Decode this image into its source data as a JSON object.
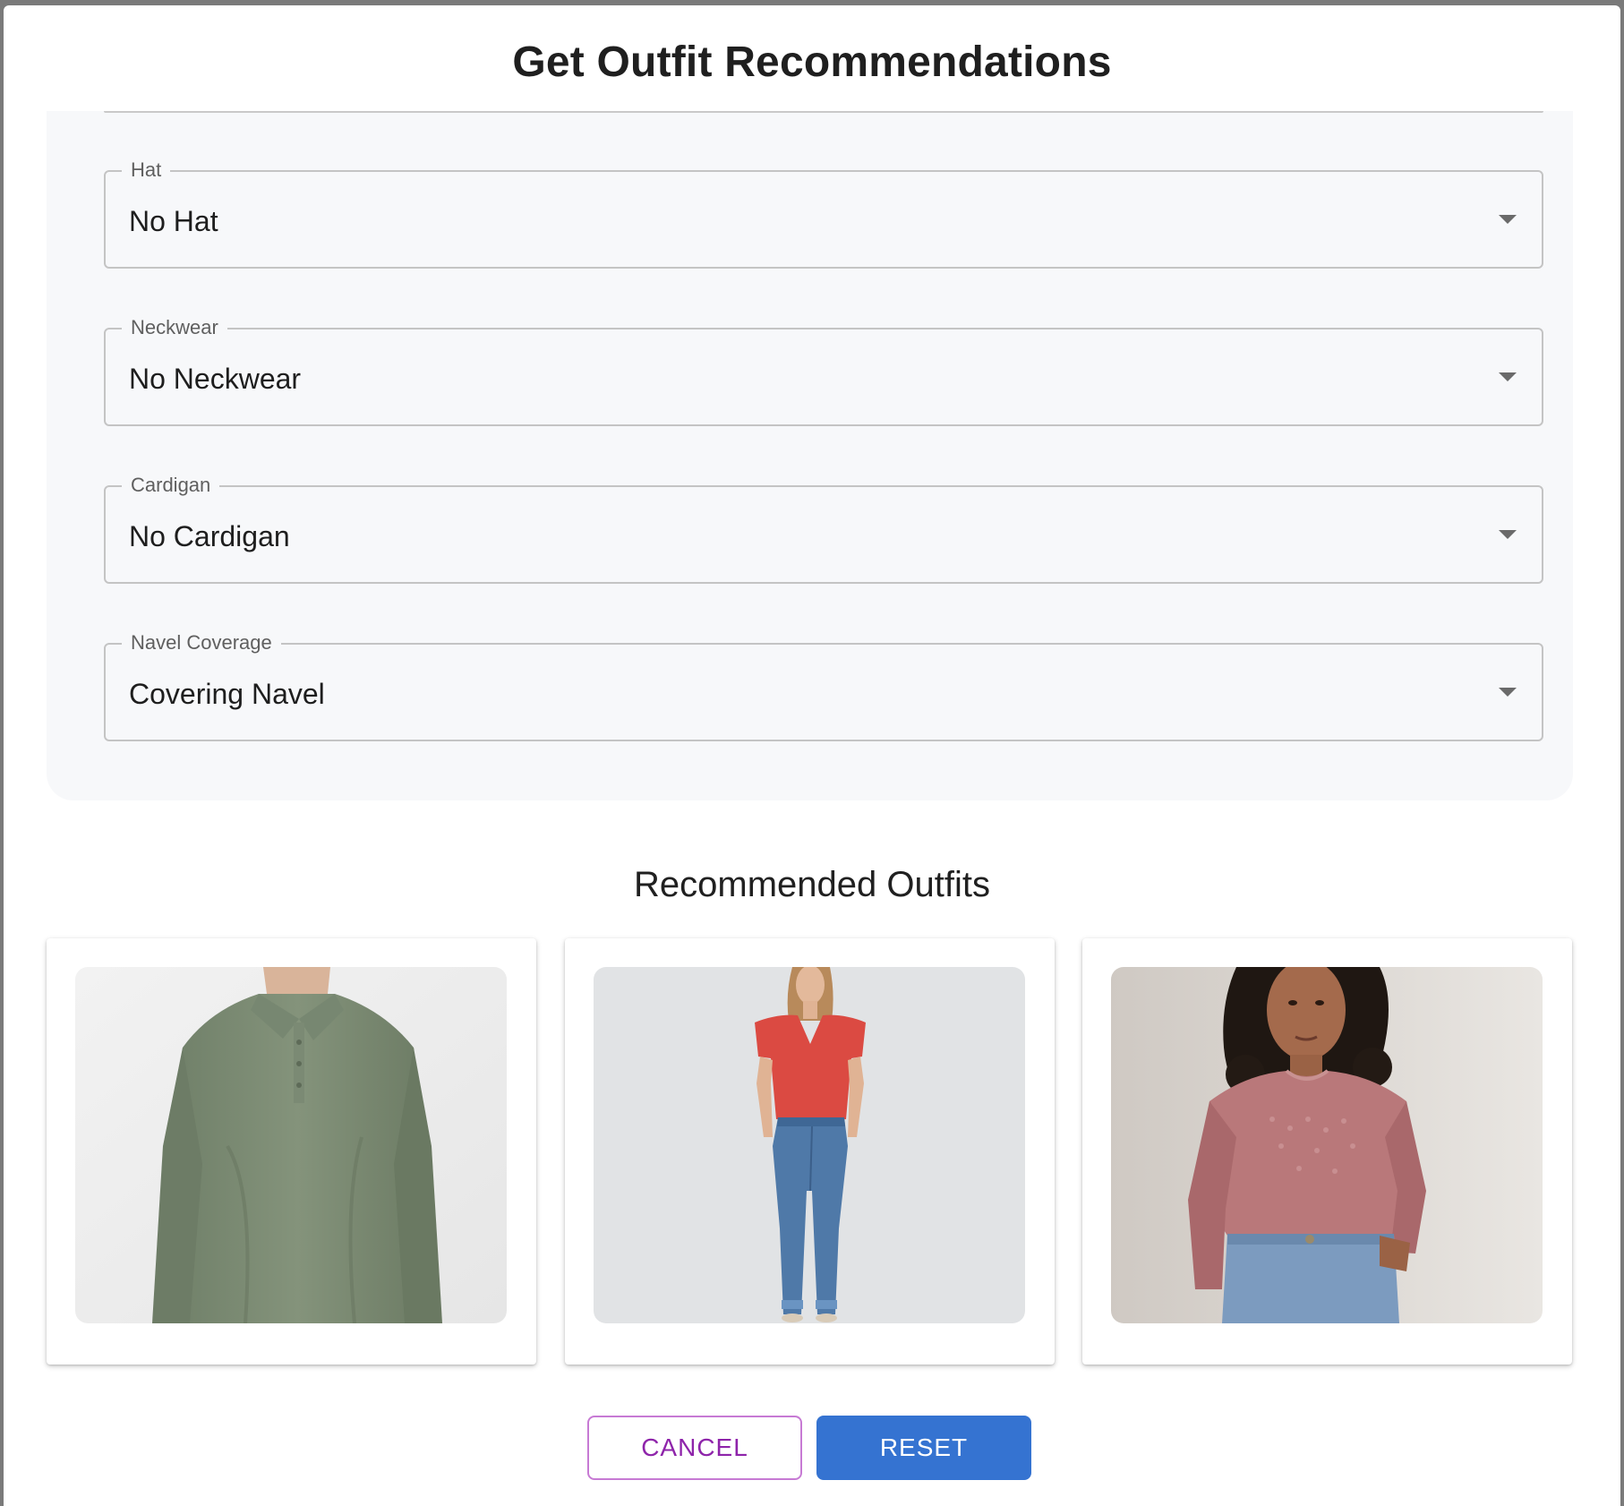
{
  "dialog": {
    "title": "Get Outfit Recommendations"
  },
  "filters": [
    {
      "label": "Hat",
      "value": "No Hat"
    },
    {
      "label": "Neckwear",
      "value": "No Neckwear"
    },
    {
      "label": "Cardigan",
      "value": "No Cardigan"
    },
    {
      "label": "Navel Coverage",
      "value": "Covering Navel"
    }
  ],
  "recommendations": {
    "heading": "Recommended Outfits"
  },
  "actions": {
    "cancel_label": "CANCEL",
    "reset_label": "RESET"
  },
  "colors": {
    "primary": "#3573d1",
    "secondary": "#8e24aa",
    "panel_bg": "#f7f8fa"
  },
  "icons": {
    "dropdown": "arrow-drop-down-icon"
  }
}
